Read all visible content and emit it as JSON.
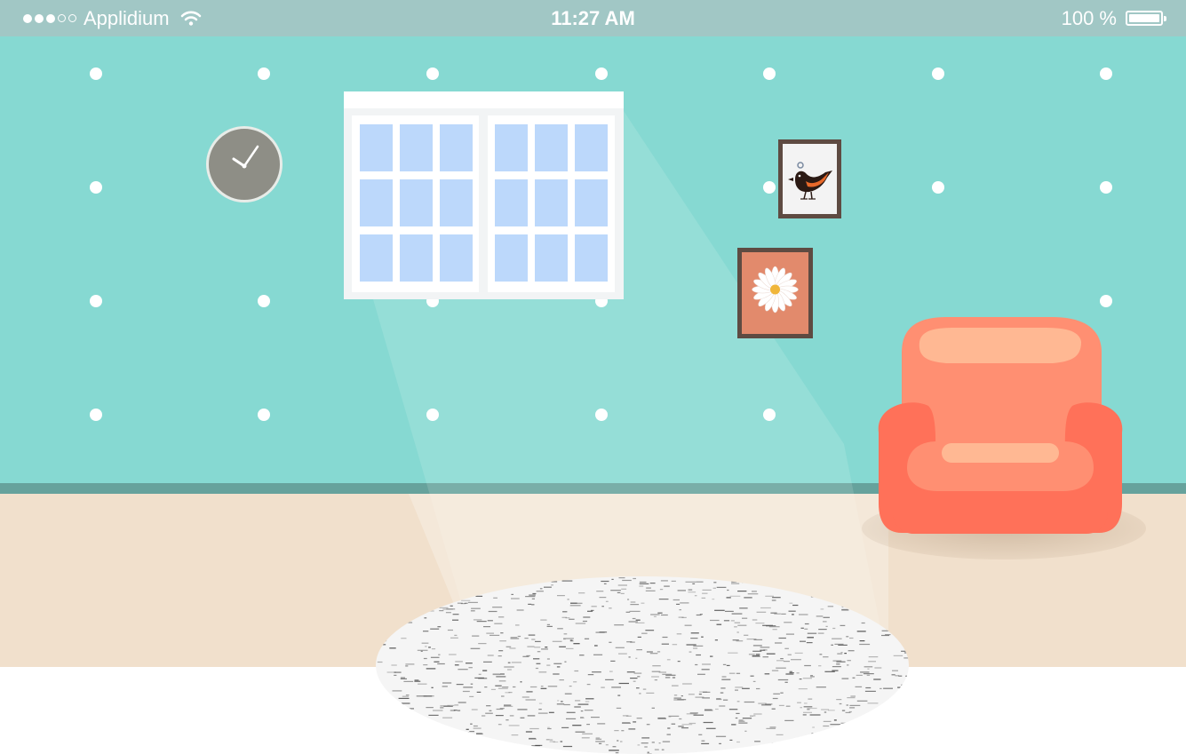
{
  "status_bar": {
    "carrier": "Applidium",
    "time": "11:27 AM",
    "battery": "100 %",
    "signal_bars_filled": 3,
    "signal_bars_total": 5,
    "icons": [
      "signal-dots-icon",
      "wifi-icon",
      "battery-icon"
    ]
  },
  "scene": {
    "objects": [
      "wall-clock",
      "window",
      "bird-picture",
      "flower-picture",
      "armchair",
      "rug"
    ],
    "colors": {
      "status_bar": "#a1c7c5",
      "wall": "#86d9d2",
      "wall_dots": "#ffffff",
      "baseboard": "#66a29c",
      "floor": "#f1e0cc",
      "window_glass": "#bcd8fb",
      "clock_face": "#8e8e86",
      "frame": "#5e4b42",
      "flower_mat": "#e28a6c",
      "armchair": "#ff8a6e",
      "armchair_highlight": "#ffb893"
    }
  }
}
